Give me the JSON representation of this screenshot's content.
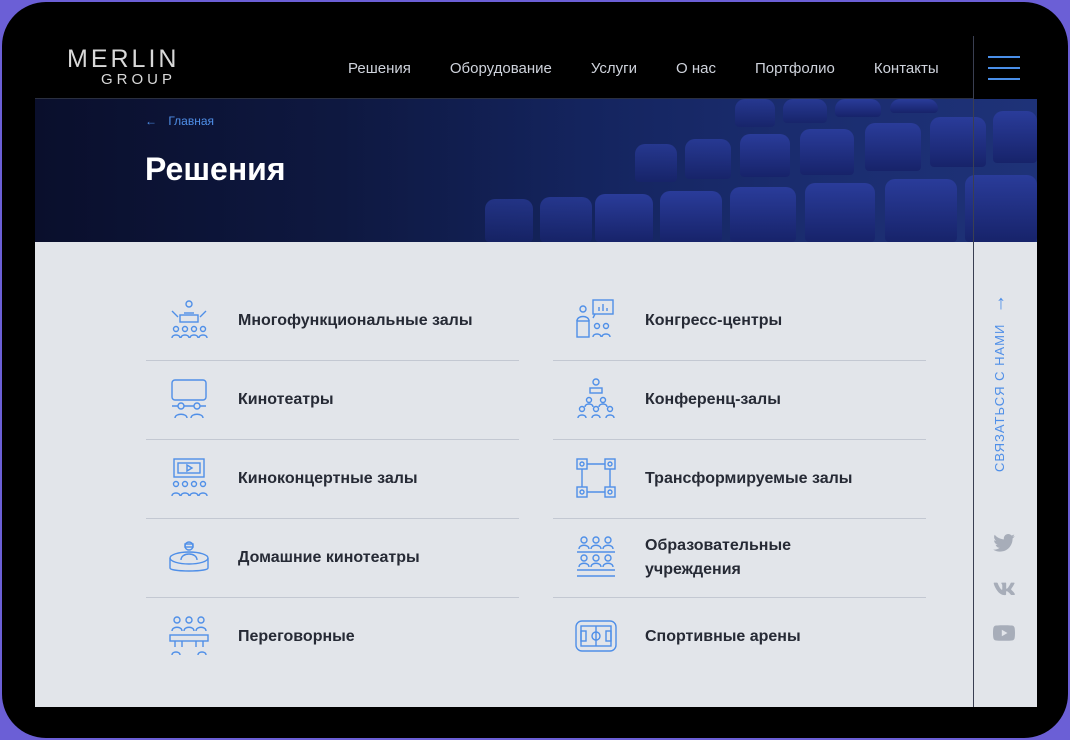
{
  "brand": {
    "line1": "MERLIN",
    "line2": "GROUP"
  },
  "nav": [
    "Решения",
    "Оборудование",
    "Услуги",
    "О нас",
    "Портфолио",
    "Контакты"
  ],
  "breadcrumb": {
    "arrow": "←",
    "label": "Главная"
  },
  "page_title": "Решения",
  "solutions": {
    "left": [
      {
        "label": "Многофункциональные залы",
        "icon": "multifunctional-hall-icon"
      },
      {
        "label": "Кинотеатры",
        "icon": "cinema-icon"
      },
      {
        "label": "Киноконцертные залы",
        "icon": "concert-cinema-icon"
      },
      {
        "label": "Домашние кинотеатры",
        "icon": "home-cinema-icon"
      },
      {
        "label": "Переговорные",
        "icon": "meeting-room-icon"
      }
    ],
    "right": [
      {
        "label": "Конгресс-центры",
        "icon": "congress-center-icon"
      },
      {
        "label": "Конференц-залы",
        "icon": "conference-hall-icon"
      },
      {
        "label": "Трансформируемые залы",
        "icon": "transformable-hall-icon"
      },
      {
        "label": "Образовательные учреждения",
        "icon": "education-icon"
      },
      {
        "label": "Спортивные арены",
        "icon": "sports-arena-icon"
      }
    ]
  },
  "contact": {
    "arrow": "↑",
    "label": "СВЯЗАТЬСЯ С НАМИ"
  },
  "social": [
    "twitter-icon",
    "vk-icon",
    "youtube-icon"
  ],
  "colors": {
    "accent": "#4f8fe8",
    "content_bg": "#e2e5ea",
    "text": "#262a35",
    "frame": "#6b5fd6"
  }
}
